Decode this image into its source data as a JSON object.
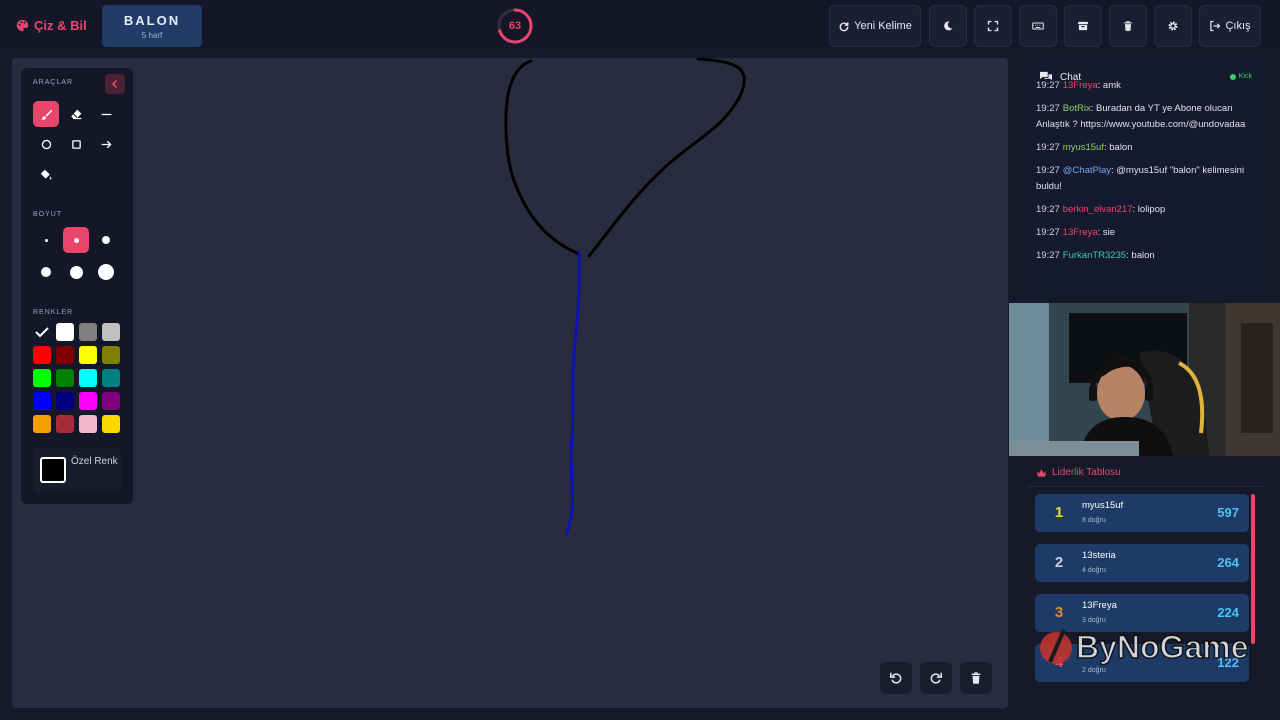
{
  "app": {
    "brand": "Çiz & Bil"
  },
  "word": {
    "text": "BALON",
    "letters": "5 harf"
  },
  "timer": {
    "value": "63",
    "fraction": 0.7
  },
  "toolbar": {
    "new_word_label": "Yeni Kelime",
    "exit_label": "Çıkış",
    "icons": [
      "moon-icon",
      "fullscreen-icon",
      "keyboard-icon",
      "archive-icon",
      "trash-icon",
      "gear-icon"
    ]
  },
  "tools": {
    "section_tools": "ARAÇLAR",
    "section_size": "BOYUT",
    "section_colors": "RENKLER",
    "custom_color_label": "Özel Renk",
    "active_tool": "brush",
    "active_size_index": 1,
    "colors": [
      "#000000",
      "#ffffff",
      "#808080",
      "#c0c0c0",
      "#ff0000",
      "#800000",
      "#ffff00",
      "#808000",
      "#00ff00",
      "#008000",
      "#00ffff",
      "#008080",
      "#0000ff",
      "#000080",
      "#ff00ff",
      "#800080",
      "#f5a000",
      "#a52a3a",
      "#f4b6c8",
      "#ffd700"
    ]
  },
  "chat": {
    "title": "Chat",
    "platform": "Kick",
    "messages": [
      {
        "time": "19:27",
        "user": "13Freya",
        "text": ": amk",
        "color": "#e8476b"
      },
      {
        "time": "19:27",
        "user": "BotRix",
        "text": ": Buradan da YT ye Abone olucan Anlaştık ? https://www.youtube.com/@undovadaa",
        "color": "#8cd36a"
      },
      {
        "time": "19:27",
        "user": "myus15uf",
        "text": ": balon",
        "color": "#8cd36a"
      },
      {
        "time": "19:27",
        "user": "@ChatPlay",
        "text": ": @myus15uf \"balon\" kelimesini buldu!",
        "color": "#7aa8f0"
      },
      {
        "time": "19:27",
        "user": "berkin_elvan217",
        "text": ": lolipop",
        "color": "#e8476b"
      },
      {
        "time": "19:27",
        "user": "13Freya",
        "text": ": sie",
        "color": "#e8476b"
      },
      {
        "time": "19:27",
        "user": "FurkanTR3235",
        "text": ": balon",
        "color": "#3ec9a8"
      }
    ]
  },
  "leaderboard": {
    "title": "Liderlik Tablosu",
    "rows": [
      {
        "rank": "1",
        "name": "myus15uf",
        "correct": "8 doğru",
        "score": "597",
        "rank_color": "#f5d442"
      },
      {
        "rank": "2",
        "name": "13steria",
        "correct": "4 doğru",
        "score": "264",
        "rank_color": "#c9ced8"
      },
      {
        "rank": "3",
        "name": "13Freya",
        "correct": "3 doğru",
        "score": "224",
        "rank_color": "#e08a3c"
      },
      {
        "rank": "4",
        "name": "",
        "correct": "2 doğru",
        "score": "122",
        "rank_color": "#e8476b"
      }
    ]
  },
  "watermark": {
    "text": "ByNoGame"
  }
}
